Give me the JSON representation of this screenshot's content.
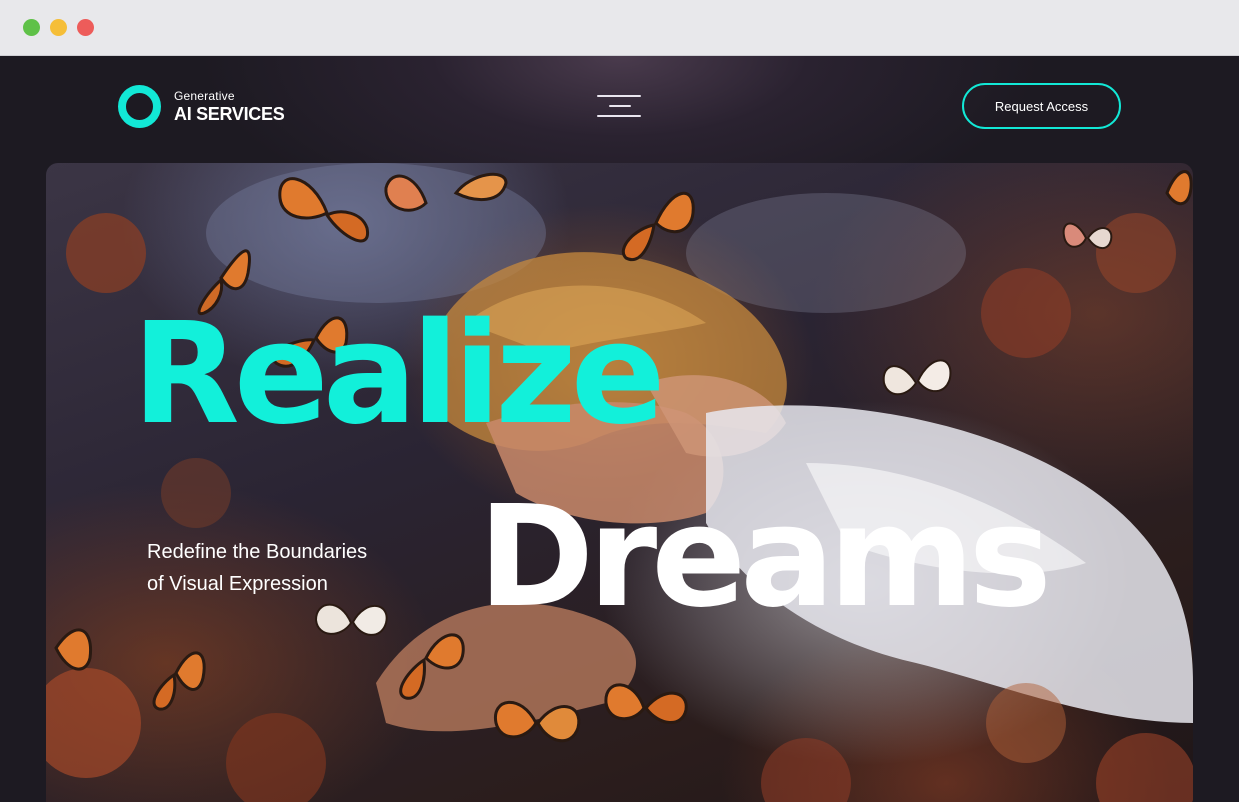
{
  "window": {
    "controls": [
      "close",
      "minimize",
      "zoom"
    ],
    "colors": {
      "green": "#5fc148",
      "yellow": "#f5be38",
      "red": "#ed5c5a"
    }
  },
  "header": {
    "logo_small": "Generative",
    "logo_big": "AI SERVICES",
    "menu_icon": "hamburger-menu-icon",
    "cta_label": "Request Access"
  },
  "hero": {
    "headline_line1": "Realize",
    "headline_line2": "Dreams",
    "subtitle_line1": "Redefine the Boundaries",
    "subtitle_line2": "of Visual Expression",
    "image_subject": "woman-sleeping-among-butterflies-image"
  },
  "colors": {
    "accent": "#12e8d6",
    "background": "#1d1a22",
    "text": "#ffffff",
    "butterfly_orange": "#e07a2e"
  }
}
